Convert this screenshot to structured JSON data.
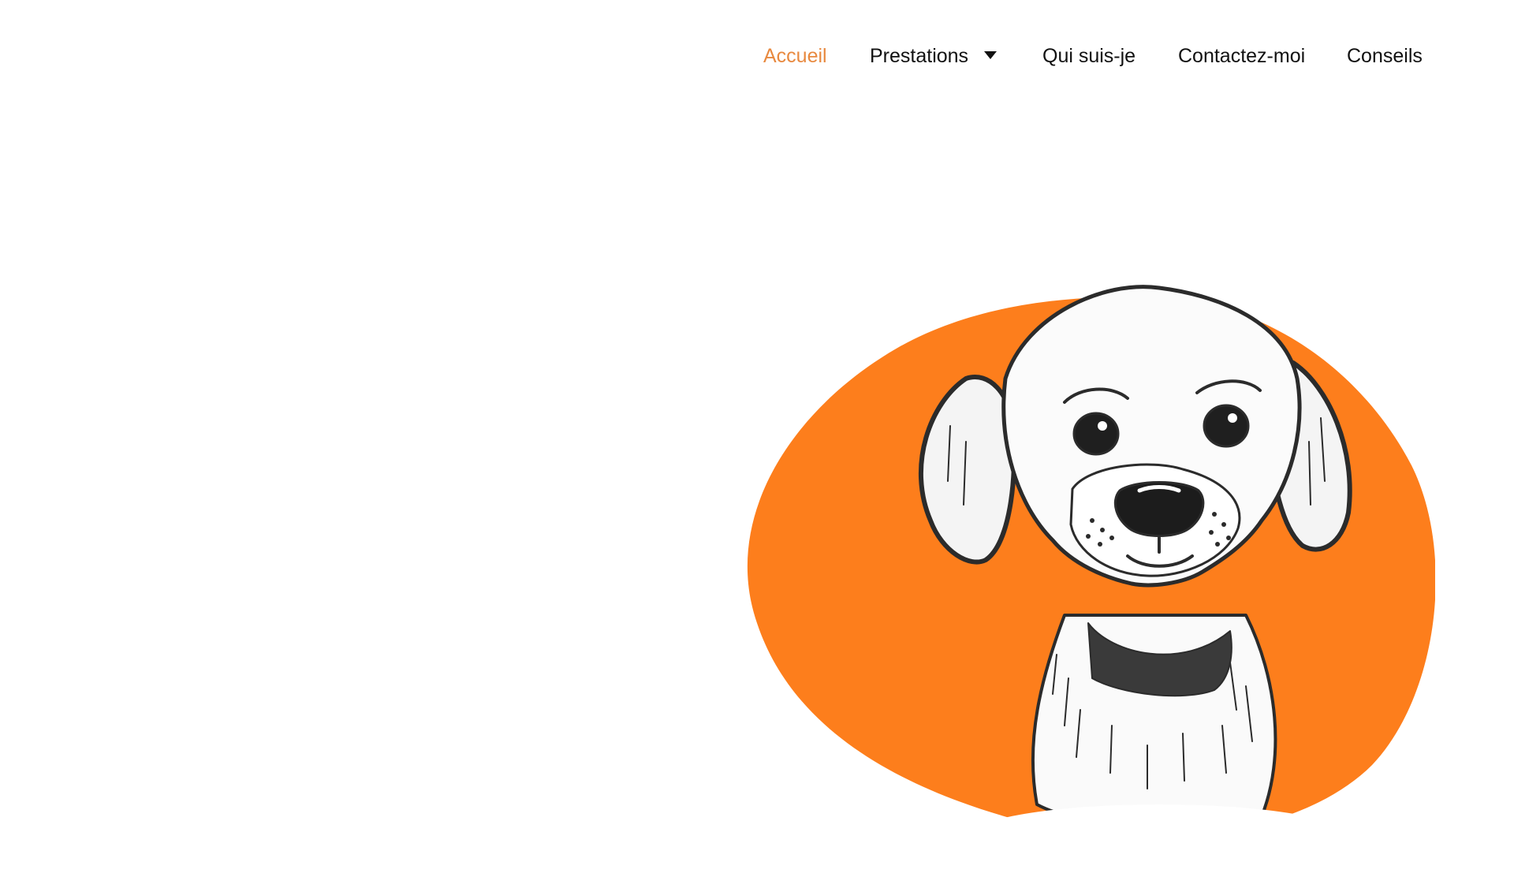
{
  "nav": {
    "items": [
      {
        "label": "Accueil",
        "active": true
      },
      {
        "label": "Prestations",
        "has_dropdown": true
      },
      {
        "label": "Qui suis-je"
      },
      {
        "label": "Contactez-moi"
      },
      {
        "label": "Conseils"
      }
    ]
  },
  "colors": {
    "accent": "#e8893f",
    "blob": "#fd7e1c",
    "text": "#111111",
    "background": "#ffffff",
    "ink": "#2b2b2b"
  },
  "hero": {
    "image": "beagle-puppy-illustration"
  }
}
